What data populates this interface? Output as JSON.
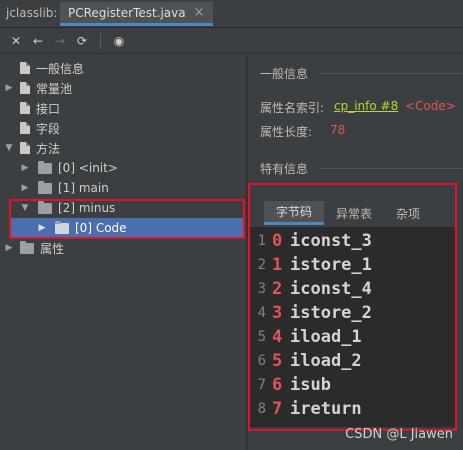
{
  "app_label": "jclasslib:",
  "tab": {
    "label": "PCRegisterTest.java",
    "close": "×"
  },
  "toolbar": {
    "close": "✕",
    "back": "←",
    "forward": "→",
    "refresh": "⟳",
    "browser": "◉"
  },
  "tree": {
    "general": "一般信息",
    "constant_pool": "常量池",
    "interfaces": "接口",
    "fields": "字段",
    "methods": "方法",
    "m0": "[0] <init>",
    "m1": "[1] main",
    "m2": "[2] minus",
    "code": "[0] Code",
    "attributes": "属性"
  },
  "general_info": {
    "title": "一般信息",
    "name_index_label": "属性名索引:",
    "name_index_link": "cp_info #8",
    "name_index_value": "<Code>",
    "length_label": "属性长度:",
    "length_value": "78"
  },
  "specific_info": {
    "title": "特有信息"
  },
  "subtabs": {
    "bytecode": "字节码",
    "exceptions": "异常表",
    "misc": "杂项"
  },
  "bytecode": [
    {
      "line": "1",
      "pc": "0",
      "op": "iconst_3"
    },
    {
      "line": "2",
      "pc": "1",
      "op": "istore_1"
    },
    {
      "line": "3",
      "pc": "2",
      "op": "iconst_4"
    },
    {
      "line": "4",
      "pc": "3",
      "op": "istore_2"
    },
    {
      "line": "5",
      "pc": "4",
      "op": "iload_1"
    },
    {
      "line": "6",
      "pc": "5",
      "op": "iload_2"
    },
    {
      "line": "7",
      "pc": "6",
      "op": "isub"
    },
    {
      "line": "8",
      "pc": "7",
      "op": "ireturn"
    }
  ],
  "watermark": "CSDN @L Jiawen",
  "colors": {
    "accent": "#4a88c7",
    "highlight_box": "#e81123",
    "pc_number": "#e05555",
    "link": "#b8d336"
  }
}
